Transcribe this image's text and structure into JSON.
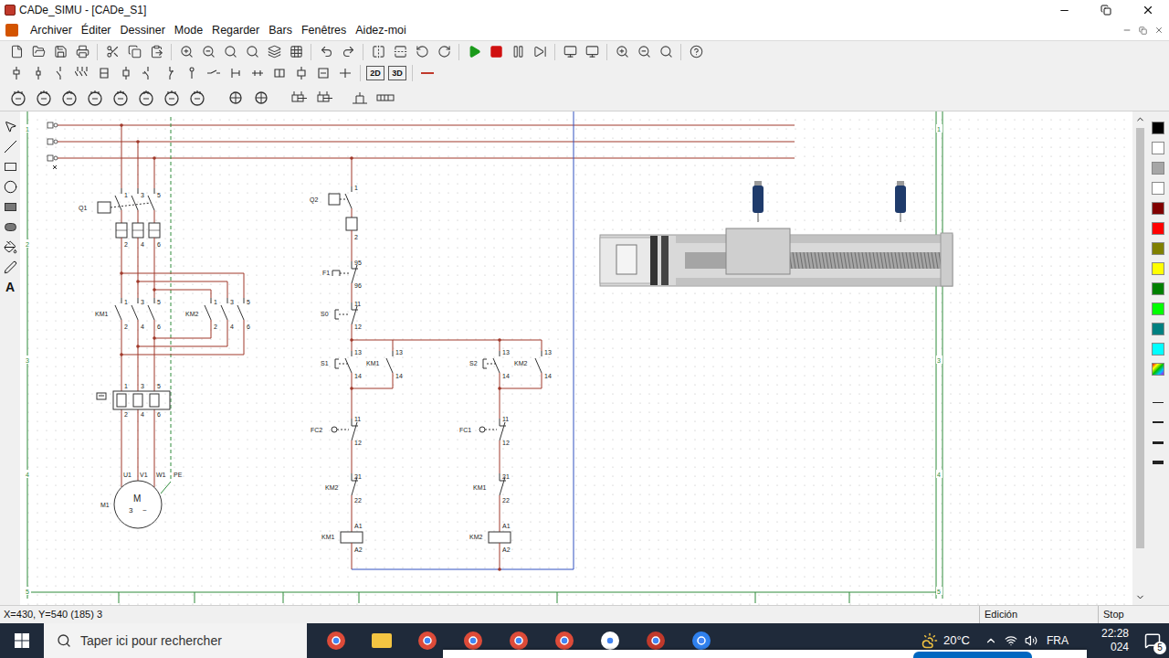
{
  "window": {
    "title": "CADe_SIMU - [CADe_S1]"
  },
  "menu": [
    "Archiver",
    "Éditer",
    "Dessiner",
    "Mode",
    "Regarder",
    "Bars",
    "Fenêtres",
    "Aidez-moi"
  ],
  "toolbar": {
    "text_buttons": [
      "2D",
      "3D"
    ]
  },
  "tools": [
    {
      "kind": "select",
      "selected": false
    },
    {
      "kind": "line",
      "selected": false
    },
    {
      "kind": "rect",
      "selected": false
    },
    {
      "kind": "ellipse",
      "selected": false
    },
    {
      "kind": "filled-rect",
      "selected": false
    },
    {
      "kind": "filled-ellipse",
      "selected": false
    },
    {
      "kind": "fill",
      "selected": false
    },
    {
      "kind": "pen",
      "selected": false
    },
    {
      "kind": "text",
      "label": "A",
      "selected": false
    }
  ],
  "palette": [
    {
      "kind": "swatch",
      "color": "#000000",
      "selected": false
    },
    {
      "kind": "swatch",
      "color": "#ffffff",
      "selected": false
    },
    {
      "kind": "swatch",
      "color": "#a6a6a6",
      "selected": false
    },
    {
      "kind": "swatch",
      "color": "#ffffff",
      "selected": false
    },
    {
      "kind": "swatch",
      "color": "#800000",
      "selected": false
    },
    {
      "kind": "swatch",
      "color": "#ff0000",
      "selected": false
    },
    {
      "kind": "swatch",
      "color": "#808000",
      "selected": false
    },
    {
      "kind": "swatch",
      "color": "#ffff00",
      "selected": false
    },
    {
      "kind": "swatch",
      "color": "#008000",
      "selected": false
    },
    {
      "kind": "swatch",
      "color": "#00ff00",
      "selected": false
    },
    {
      "kind": "swatch",
      "color": "#008080",
      "selected": false
    },
    {
      "kind": "swatch",
      "color": "#00ffff",
      "selected": false
    },
    {
      "kind": "custom",
      "selected": false
    }
  ],
  "schematic": {
    "row_markers": [
      "1",
      "2",
      "3",
      "4",
      "5"
    ],
    "components": [
      {
        "kind": "pole3",
        "name": "Q1",
        "terminals": [
          "1",
          "3",
          "5",
          "2",
          "4",
          "6"
        ]
      },
      {
        "kind": "pole3",
        "name": "KM1",
        "terminals": [
          "1",
          "3",
          "5",
          "2",
          "4",
          "6"
        ]
      },
      {
        "kind": "pole3",
        "name": "KM2",
        "terminals": [
          "1",
          "3",
          "5",
          "2",
          "4",
          "6"
        ]
      },
      {
        "kind": "pole3",
        "terminals": [
          "1",
          "3",
          "5",
          "2",
          "4",
          "6"
        ]
      },
      {
        "kind": "motor",
        "name": "M1",
        "terminals": [
          "U1",
          "V1",
          "W1",
          "PE"
        ],
        "symbol": [
          "M",
          "3",
          "~"
        ]
      },
      {
        "kind": "pole1",
        "name": "Q2",
        "terminals": [
          "1",
          "2"
        ]
      },
      {
        "kind": "pole1",
        "name": "F1",
        "terminals": [
          "95",
          "96"
        ]
      },
      {
        "kind": "pole1",
        "name": "S0",
        "terminals": [
          "11",
          "12"
        ]
      },
      {
        "kind": "pole1",
        "name": "S1",
        "terminals": [
          "13",
          "14"
        ]
      },
      {
        "kind": "pole1",
        "name": "KM1",
        "terminals": [
          "13",
          "14"
        ]
      },
      {
        "kind": "pole1",
        "name": "S2",
        "terminals": [
          "13",
          "14"
        ]
      },
      {
        "kind": "pole1",
        "name": "KM2",
        "terminals": [
          "13",
          "14"
        ]
      },
      {
        "kind": "pole1",
        "name": "FC2",
        "terminals": [
          "11",
          "12"
        ]
      },
      {
        "kind": "pole1",
        "name": "FC1",
        "terminals": [
          "11",
          "12"
        ]
      },
      {
        "kind": "pole1",
        "name": "KM2",
        "terminals": [
          "21",
          "22"
        ]
      },
      {
        "kind": "pole1",
        "name": "KM1",
        "terminals": [
          "21",
          "22"
        ]
      },
      {
        "kind": "pole1",
        "name": "KM1",
        "terminals": [
          "A1",
          "A2"
        ]
      },
      {
        "kind": "pole1",
        "name": "KM2",
        "terminals": [
          "A1",
          "A2"
        ]
      }
    ]
  },
  "status_bar": {
    "coords": "X=430, Y=540 (185) 3",
    "mode": "Edición",
    "simulation": "Stop"
  },
  "taskbar": {
    "search_placeholder": "Taper ici pour rechercher",
    "weather": "20°C",
    "language": "FRA",
    "time": "22:28",
    "date": "024",
    "notifications": "5"
  }
}
